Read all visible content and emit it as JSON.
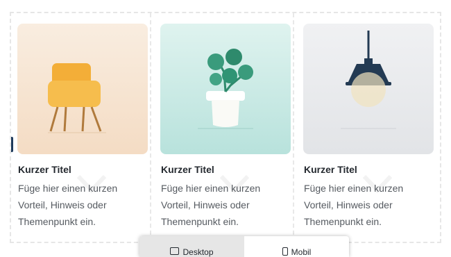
{
  "cards": [
    {
      "title": "Kurzer Titel",
      "lines": [
        "Füge hier einen kurzen",
        "Vorteil, Hinweis oder",
        "Themenpunkt ein."
      ],
      "illustration": "chair-illustration",
      "bg": "#f6e4d2"
    },
    {
      "title": "Kurzer Titel",
      "lines": [
        "Füge hier einen kurzen",
        "Vorteil, Hinweis oder",
        "Themenpunkt ein."
      ],
      "illustration": "plant-illustration",
      "bg": "#c9ebe6"
    },
    {
      "title": "Kurzer Titel",
      "lines": [
        "Füge hier einen kurzen",
        "Vorteil, Hinweis oder",
        "Themenpunkt ein."
      ],
      "illustration": "lamp-illustration",
      "bg": "#e8e9eb"
    }
  ],
  "view_toggle": {
    "desktop_label": "Desktop",
    "mobile_label": "Mobil",
    "active": "desktop",
    "desktop_icon": "monitor-icon",
    "mobile_icon": "phone-icon"
  },
  "colors": {
    "accent_dark": "#24292f",
    "border_dashed": "#e6e6e6",
    "toggle_active": "#e6e6e6"
  }
}
